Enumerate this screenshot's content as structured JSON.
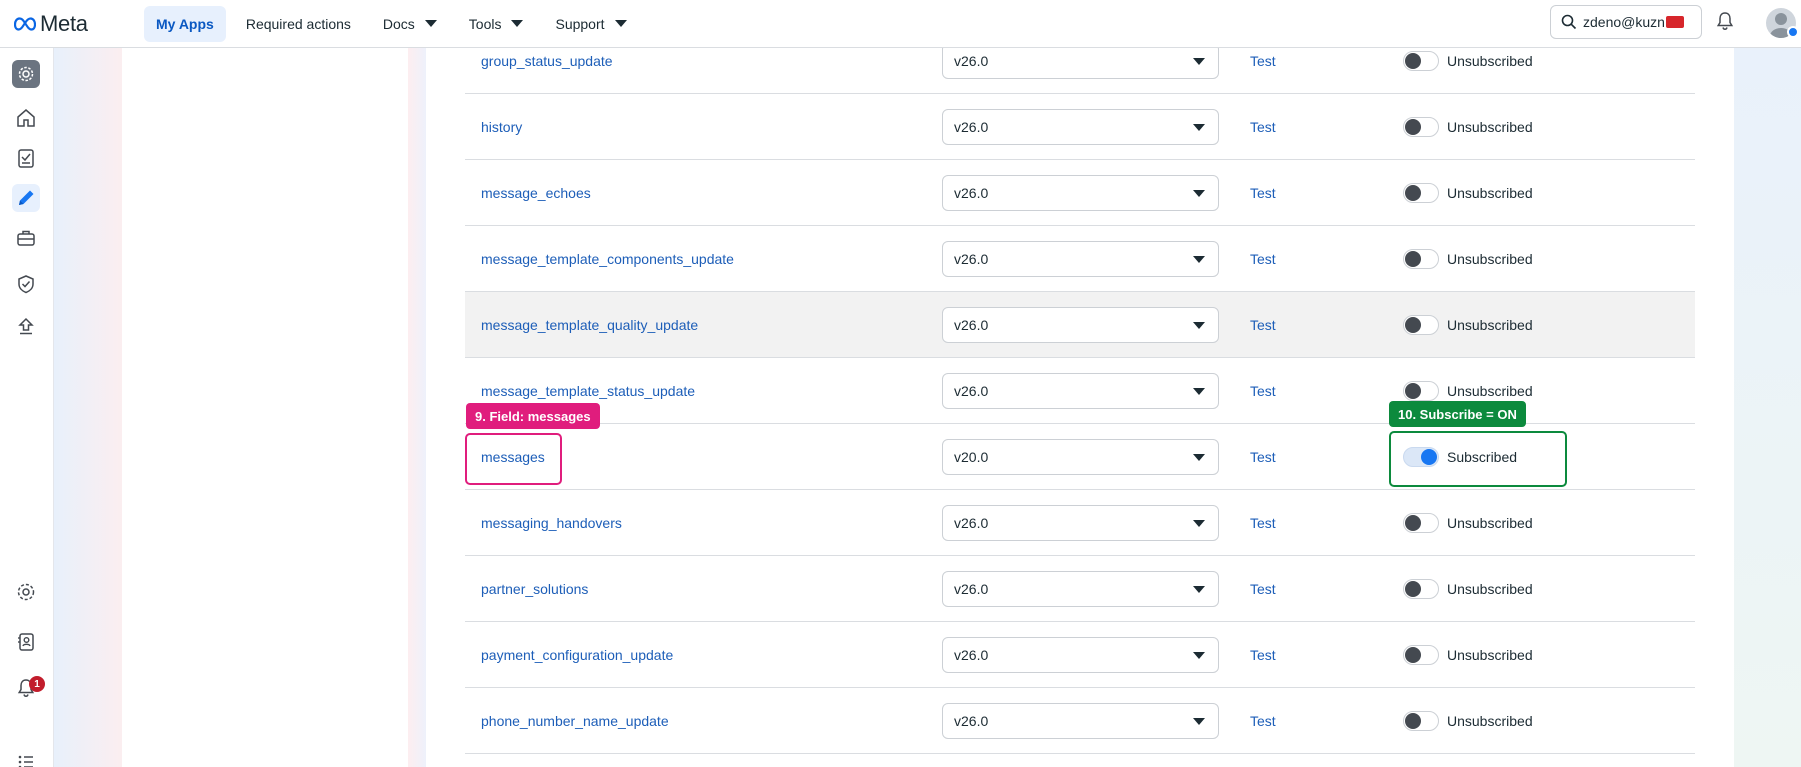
{
  "brand": {
    "name": "Meta"
  },
  "nav": [
    {
      "label": "My Apps",
      "active": true,
      "dropdown": false
    },
    {
      "label": "Required actions",
      "active": false,
      "dropdown": false
    },
    {
      "label": "Docs",
      "active": false,
      "dropdown": true
    },
    {
      "label": "Tools",
      "active": false,
      "dropdown": true
    },
    {
      "label": "Support",
      "active": false,
      "dropdown": true
    }
  ],
  "search": {
    "value": "zdeno@kuzn"
  },
  "rail": {
    "icons": [
      "app-settings-icon",
      "home-icon",
      "checklist-icon",
      "pencil-icon",
      "briefcase-icon",
      "shield-check-icon",
      "upload-icon",
      "gear-icon",
      "contacts-icon",
      "bell-icon",
      "list-icon"
    ],
    "selected": "pencil-icon",
    "notification_count": "1"
  },
  "rows": [
    {
      "field": "group_status_update",
      "version": "v26.0",
      "test": "Test",
      "status": "Unsubscribed",
      "subscribed": false
    },
    {
      "field": "history",
      "version": "v26.0",
      "test": "Test",
      "status": "Unsubscribed",
      "subscribed": false
    },
    {
      "field": "message_echoes",
      "version": "v26.0",
      "test": "Test",
      "status": "Unsubscribed",
      "subscribed": false
    },
    {
      "field": "message_template_components_update",
      "version": "v26.0",
      "test": "Test",
      "status": "Unsubscribed",
      "subscribed": false
    },
    {
      "field": "message_template_quality_update",
      "version": "v26.0",
      "test": "Test",
      "status": "Unsubscribed",
      "subscribed": false
    },
    {
      "field": "message_template_status_update",
      "version": "v26.0",
      "test": "Test",
      "status": "Unsubscribed",
      "subscribed": false
    },
    {
      "field": "messages",
      "version": "v20.0",
      "test": "Test",
      "status": "Subscribed",
      "subscribed": true
    },
    {
      "field": "messaging_handovers",
      "version": "v26.0",
      "test": "Test",
      "status": "Unsubscribed",
      "subscribed": false
    },
    {
      "field": "partner_solutions",
      "version": "v26.0",
      "test": "Test",
      "status": "Unsubscribed",
      "subscribed": false
    },
    {
      "field": "payment_configuration_update",
      "version": "v26.0",
      "test": "Test",
      "status": "Unsubscribed",
      "subscribed": false
    },
    {
      "field": "phone_number_name_update",
      "version": "v26.0",
      "test": "Test",
      "status": "Unsubscribed",
      "subscribed": false
    }
  ],
  "annotations": {
    "field_label": "9. Field: messages",
    "subscribe_label": "10. Subscribe = ON",
    "field_color": "#e01d7d",
    "subscribe_color": "#0c8a3d"
  },
  "colors": {
    "link": "#1d5eb8",
    "toggle_on": "#1877f2",
    "nav_active_bg": "#e7f0fd"
  }
}
